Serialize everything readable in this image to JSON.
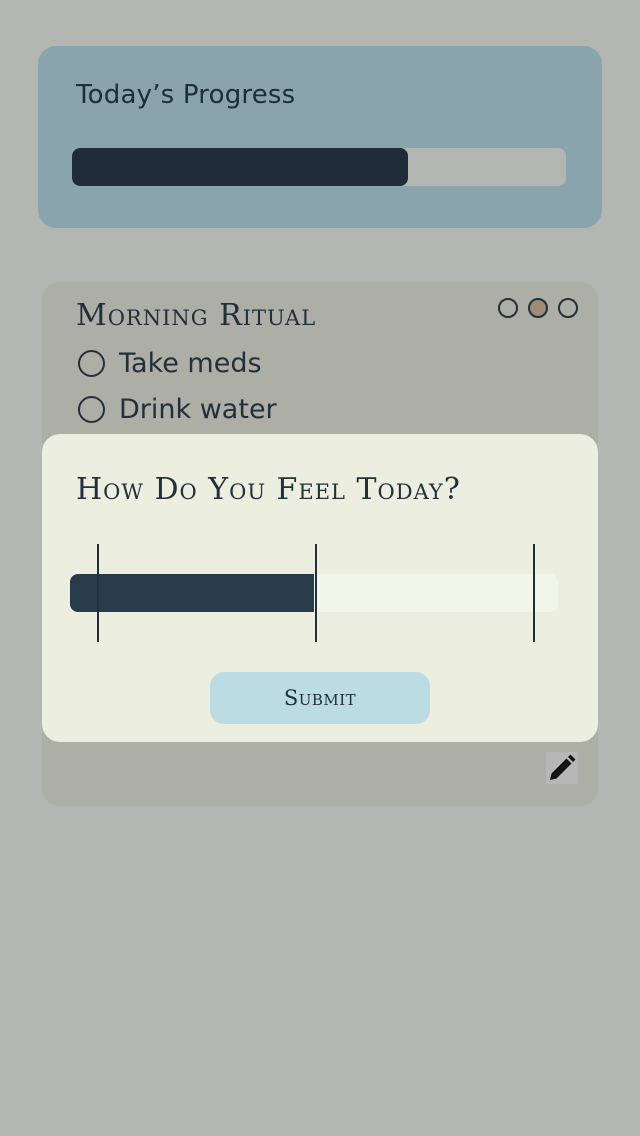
{
  "progress": {
    "title": "Today’s Progress",
    "fraction": 0.68
  },
  "ritual": {
    "title": "Morning Ritual",
    "dots": [
      {
        "color": "transparent"
      },
      {
        "color": "#9e8a75"
      },
      {
        "color": "transparent"
      }
    ],
    "tasks": [
      {
        "label": "Take meds",
        "done": false
      },
      {
        "label": "Drink water",
        "done": false
      }
    ],
    "edit_icon": "pencil-icon"
  },
  "mood_modal": {
    "title": "How Do You Feel Today?",
    "slider_fraction": 0.5,
    "submit_label": "Submit"
  },
  "colors": {
    "background": "#b4b7b1",
    "progress_card": "#8aa4ad",
    "progress_fill": "#1f2d3b",
    "modal_bg": "#eceee0",
    "submit_button": "#bcdce3"
  }
}
